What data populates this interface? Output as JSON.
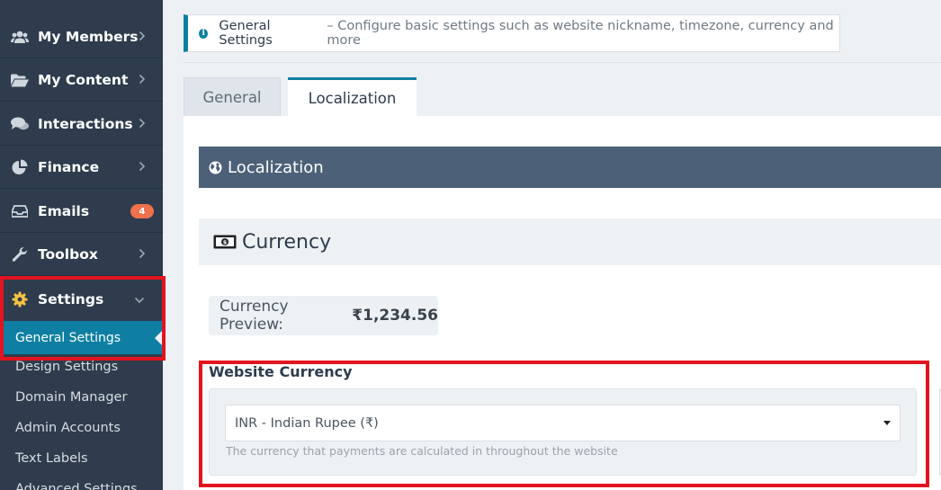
{
  "sidebar": {
    "items": [
      {
        "label": "My Members",
        "icon": "users-icon"
      },
      {
        "label": "My Content",
        "icon": "folder-open-icon"
      },
      {
        "label": "Interactions",
        "icon": "comments-icon"
      },
      {
        "label": "Finance",
        "icon": "pie-chart-icon"
      },
      {
        "label": "Emails",
        "icon": "inbox-icon",
        "badge": "4"
      },
      {
        "label": "Toolbox",
        "icon": "wrench-icon"
      },
      {
        "label": "Settings",
        "icon": "gear-icon"
      }
    ],
    "settings_sub": [
      "General Settings",
      "Design Settings",
      "Domain Manager",
      "Admin Accounts",
      "Text Labels",
      "Advanced Settings"
    ]
  },
  "banner": {
    "title": "General Settings",
    "description": "– Configure basic settings such as website nickname, timezone, currency and more"
  },
  "tabs": [
    "General",
    "Localization"
  ],
  "section": {
    "title": "Localization",
    "subsection": "Currency"
  },
  "preview": {
    "label": "Currency Preview:",
    "value": "₹1,234.56"
  },
  "currency_field": {
    "label": "Website Currency",
    "selected": "INR - Indian Rupee (₹)",
    "help": "The currency that payments are calculated in throughout the website"
  },
  "colors": {
    "sidebar": "#2e3c4d",
    "accent": "#0e7fa3",
    "header": "#4c6078",
    "badge": "#f0714b",
    "highlight": "#e3131f"
  }
}
